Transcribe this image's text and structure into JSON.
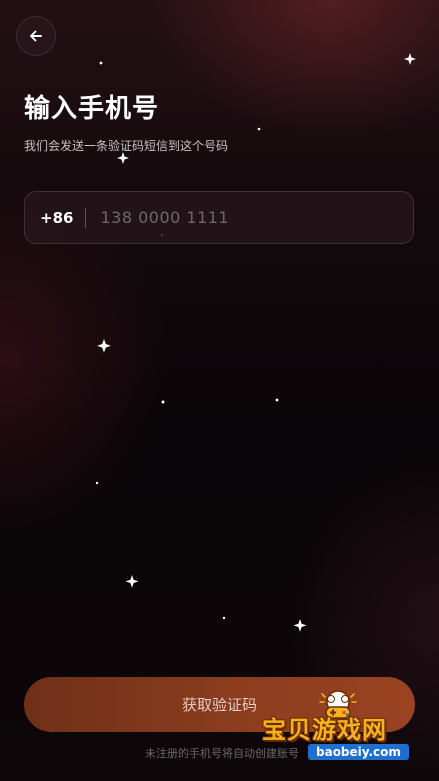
{
  "header": {
    "back_icon": "arrow-left-icon",
    "title": "输入手机号",
    "subtitle": "我们会发送一条验证码短信到这个号码"
  },
  "phone": {
    "country_code": "+86",
    "placeholder": "138 0000 1111",
    "value": ""
  },
  "actions": {
    "get_code_label": "获取验证码"
  },
  "footer": {
    "note": "未注册的手机号将自动创建账号"
  },
  "watermark": {
    "text": "宝贝游戏网",
    "url": "baobeiy.com"
  },
  "colors": {
    "background": "#0b0508",
    "button_gradient_start": "#6f3018",
    "button_gradient_end": "#9a4322",
    "watermark_yellow": "#f5b21a",
    "watermark_blue": "#1f6fd1"
  }
}
